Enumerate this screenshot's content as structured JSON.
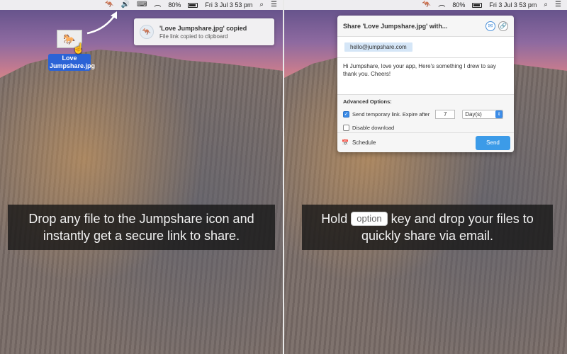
{
  "menubar": {
    "battery_percent": "80%",
    "datetime": "Fri 3 Jul  3 53 pm"
  },
  "left": {
    "file_label": "Love Jumpshare.jpg",
    "notification": {
      "title": "'Love Jumpshare.jpg' copied",
      "subtitle": "File link copied to clipboard"
    },
    "caption_line1": "Drop any file to the Jumpshare icon and",
    "caption_line2": "instantly get a secure link to share."
  },
  "right": {
    "popup": {
      "title": "Share 'Love Jumpshare.jpg' with...",
      "recipient": "hello@jumpshare.com",
      "message": "Hi Jumpshare, love your app, Here's something I drew to say thank you. Cheers!",
      "advanced_title": "Advanced Options:",
      "temp_link_label": "Send temporary link. Expire after",
      "temp_link_checked": true,
      "expire_value": "7",
      "expire_unit": "Day(s)",
      "disable_download_label": "Disable download",
      "disable_download_checked": false,
      "schedule_label": "Schedule",
      "send_label": "Send"
    },
    "caption_pre": "Hold",
    "caption_key": "option",
    "caption_post": "key and drop your files to",
    "caption_line2": "quickly share via email."
  },
  "colors": {
    "accent": "#3c9be8",
    "chip": "#d5e6f7",
    "file_label_bg": "#2b63d6"
  }
}
